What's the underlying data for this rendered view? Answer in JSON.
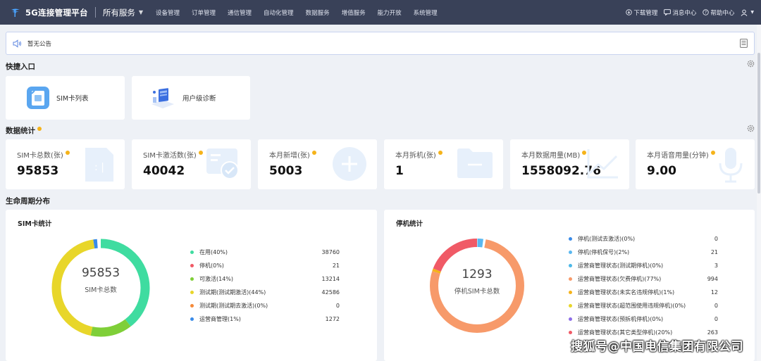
{
  "topbar": {
    "app_title": "5G连接管理平台",
    "all_services": "所有服务",
    "nav": [
      "设备管理",
      "订单管理",
      "通信管理",
      "自动化管理",
      "数据服务",
      "增值服务",
      "能力开放",
      "系统管理"
    ],
    "download": "下载管理",
    "messages": "消息中心",
    "help": "帮助中心"
  },
  "notice": {
    "text": "暂无公告"
  },
  "quick": {
    "title": "快捷入口",
    "items": [
      "SIM卡列表",
      "用户级诊断"
    ]
  },
  "stats": {
    "title": "数据统计",
    "cards": [
      {
        "label": "SIM卡总数(张)",
        "value": "95853"
      },
      {
        "label": "SIM卡激活数(张)",
        "value": "40042"
      },
      {
        "label": "本月新增(张)",
        "value": "5003"
      },
      {
        "label": "本月拆机(张)",
        "value": "1"
      },
      {
        "label": "本月数据用量(MB)",
        "value": "1558092.76"
      },
      {
        "label": "本月语音用量(分钟)",
        "value": "9.00"
      }
    ]
  },
  "lifecycle": {
    "title": "生命周期分布"
  },
  "sim_panel": {
    "title": "SIM卡统计",
    "center_value": "95853",
    "center_label": "SIM卡总数",
    "legend": [
      {
        "label": "在用(40%)",
        "value": "38760",
        "color": "#3fdca0"
      },
      {
        "label": "停机(0%)",
        "value": "21",
        "color": "#f05a66"
      },
      {
        "label": "可激活(14%)",
        "value": "13214",
        "color": "#7fcf38"
      },
      {
        "label": "测试期(测试期激活)(44%)",
        "value": "42586",
        "color": "#e8d62a"
      },
      {
        "label": "测试期(测试期去激活)(0%)",
        "value": "0",
        "color": "#f58a3a"
      },
      {
        "label": "运营商管理(1%)",
        "value": "1272",
        "color": "#3a8be8"
      }
    ]
  },
  "stop_panel": {
    "title": "停机统计",
    "center_value": "1293",
    "center_label": "停机SIM卡总数",
    "legend": [
      {
        "label": "停机(测试去激活)(0%)",
        "value": "0",
        "color": "#3a8be8"
      },
      {
        "label": "停机(停机保号)(2%)",
        "value": "21",
        "color": "#5ab8f0"
      },
      {
        "label": "运营商管理状态(测试期停机)(0%)",
        "value": "3",
        "color": "#4cb8e8"
      },
      {
        "label": "运营商管理状态(欠费停机)(77%)",
        "value": "994",
        "color": "#f79a6a"
      },
      {
        "label": "运营商管理状态(未实名违规停机)(1%)",
        "value": "12",
        "color": "#f5b31a"
      },
      {
        "label": "运营商管理状态(超范围使用违规停机)(0%)",
        "value": "0",
        "color": "#e8d62a"
      },
      {
        "label": "运营商管理状态(预拆机停机)(0%)",
        "value": "0",
        "color": "#8e6ee8"
      },
      {
        "label": "运营商管理状态(其它类型停机)(20%)",
        "value": "263",
        "color": "#f05a66"
      }
    ]
  },
  "watermark": "搜狐号@中国电信集团有限公司"
}
